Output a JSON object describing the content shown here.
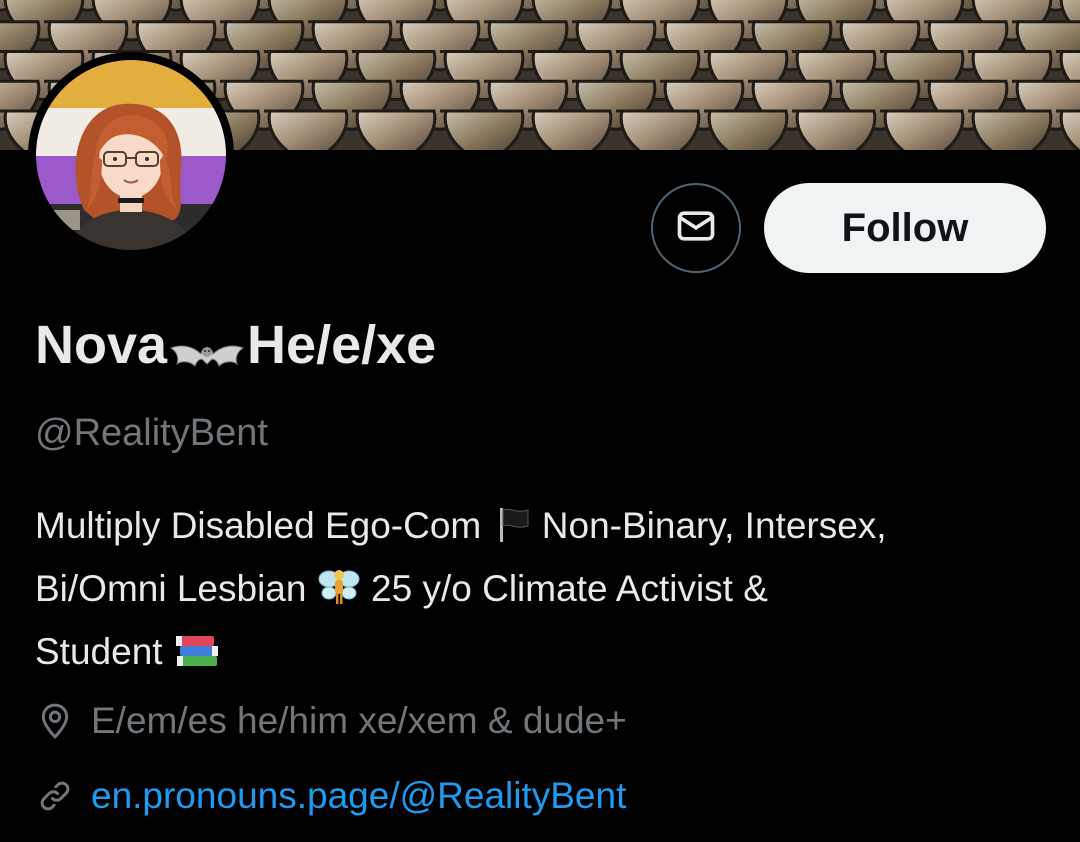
{
  "profile": {
    "name_part1": "Nova",
    "name_part2": "He/e/xe",
    "name_emoji": "bat-icon",
    "handle": "@RealityBent",
    "bio": {
      "line1_a": "Multiply Disabled Ego-Com",
      "line1_b": "Non-Binary, Intersex,",
      "line2_a": "Bi/Omni Lesbian",
      "line2_b": "25 y/o Climate Activist &",
      "line3_a": "Student"
    },
    "location": "E/em/es he/him xe/xem & dude+",
    "website": "en.pronouns.page/@RealityBent"
  },
  "actions": {
    "follow_label": "Follow",
    "message_icon": "envelope-icon"
  },
  "colors": {
    "background": "#000000",
    "primary_text": "#e7e9ea",
    "secondary_text": "#71767b",
    "link": "#1d9bf0",
    "follow_bg": "#eff3f4"
  }
}
